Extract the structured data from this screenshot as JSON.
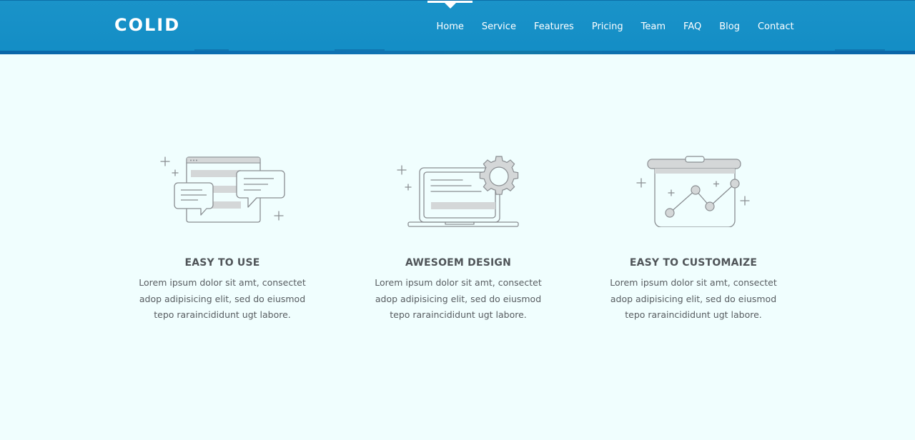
{
  "header": {
    "logo": "COLID",
    "nav": [
      {
        "label": "Home",
        "active": true
      },
      {
        "label": "Service",
        "active": false
      },
      {
        "label": "Features",
        "active": false
      },
      {
        "label": "Pricing",
        "active": false
      },
      {
        "label": "Team",
        "active": false
      },
      {
        "label": "FAQ",
        "active": false
      },
      {
        "label": "Blog",
        "active": false
      },
      {
        "label": "Contact",
        "active": false
      }
    ]
  },
  "features": [
    {
      "icon": "chat-window-icon",
      "title": "EASY TO USE",
      "lines": [
        "Lorem ipsum dolor sit amt, consectet",
        "adop adipisicing elit, sed do eiusmod",
        "tepo raraincididunt ugt labore."
      ]
    },
    {
      "icon": "laptop-gear-icon",
      "title": "AWESOEM DESIGN",
      "lines": [
        "Lorem ipsum dolor sit amt, consectet",
        "adop adipisicing elit, sed do eiusmod",
        "tepo raraincididunt ugt labore."
      ]
    },
    {
      "icon": "presentation-chart-icon",
      "title": "EASY TO CUSTOMAIZE",
      "lines": [
        "Lorem ipsum dolor sit amt, consectet",
        "adop adipisicing elit, sed do eiusmod",
        "tepo raraincididunt ugt labore."
      ]
    }
  ],
  "colors": {
    "header_bg": "#1a93c9",
    "page_bg": "#f0fefe",
    "title_text": "#505559",
    "body_text": "#585d61"
  }
}
